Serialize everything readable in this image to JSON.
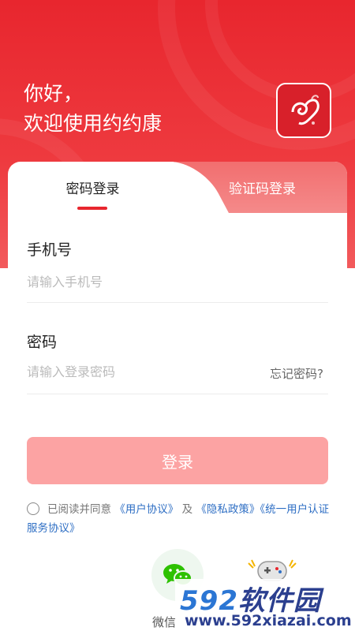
{
  "greeting": {
    "line1": "你好，",
    "line2": "欢迎使用约约康"
  },
  "tabs": {
    "password_login": "密码登录",
    "code_login": "验证码登录"
  },
  "phone": {
    "label": "手机号",
    "placeholder": "请输入手机号"
  },
  "password": {
    "label": "密码",
    "placeholder": "请输入登录密码",
    "forgot": "忘记密码?"
  },
  "login_button": "登录",
  "agreement": {
    "prefix": "已阅读并同意",
    "user_agreement": "《用户协议》",
    "and": "及",
    "privacy_policy": "《隐私政策》",
    "unified_auth": "《统一用户认证服务协议》"
  },
  "social": {
    "wechat_label": "微信"
  },
  "watermark": {
    "num": "592",
    "text": "软件园",
    "url": "www.592xiazai.com"
  },
  "colors": {
    "brand_red": "#e8262e",
    "button_disabled": "#fca3a3",
    "link_blue": "#2f6fc4",
    "wechat_green": "#2dc100"
  }
}
